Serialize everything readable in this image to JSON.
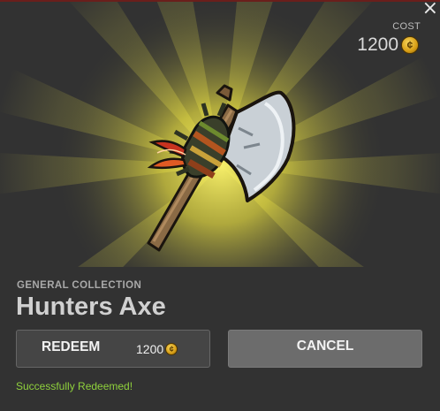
{
  "dialog": {
    "close_glyph": "×",
    "cost_label": "COST",
    "cost_value": "1200",
    "coin_glyph": "¢",
    "item": {
      "collection": "GENERAL COLLECTION",
      "name": "Hunters Axe",
      "image_icon": "hunters-axe-icon"
    },
    "redeem_button": {
      "label": "REDEEM",
      "price": "1200"
    },
    "cancel_button": {
      "label": "CANCEL"
    },
    "status_message": "Successfully Redeemed!"
  },
  "colors": {
    "background": "#323232",
    "glow": "#f4ea3a",
    "coin": "#d79e16",
    "success": "#8fd13c",
    "redeem_button": "#454545",
    "cancel_button": "#6c6c6c"
  }
}
